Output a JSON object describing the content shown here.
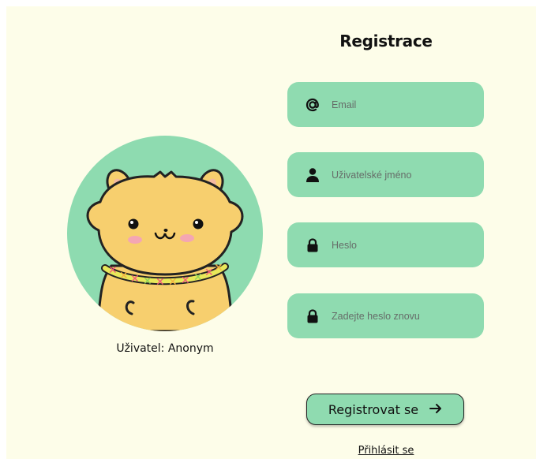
{
  "form": {
    "title": "Registrace",
    "email": {
      "placeholder": "Email",
      "icon": "at-icon"
    },
    "username": {
      "placeholder": "Uživatelské jméno",
      "icon": "user-icon"
    },
    "password": {
      "placeholder": "Heslo",
      "icon": "lock-icon"
    },
    "password_confirm": {
      "placeholder": "Zadejte heslo znovu",
      "icon": "lock-icon"
    },
    "submit_label": "Registrovat se",
    "submit_icon": "arrow-right-icon",
    "login_link": "Přihlásit se"
  },
  "profile": {
    "user_label": "Uživatel: Anonym",
    "avatar": "hamster-avatar"
  },
  "colors": {
    "background": "#fdfde9",
    "accent": "#8fdbb0",
    "text": "#111111"
  }
}
